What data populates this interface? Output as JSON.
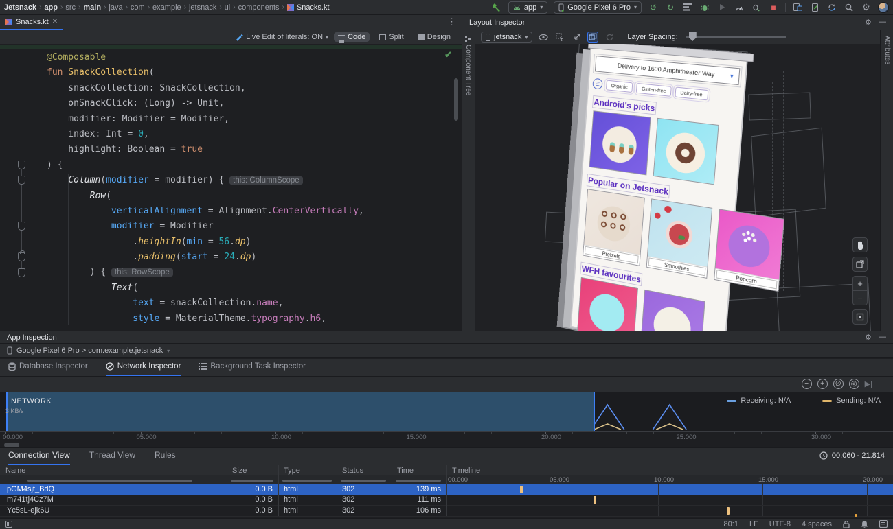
{
  "toolbar": {
    "breadcrumbs": [
      {
        "label": "Jetsnack",
        "bold": true
      },
      {
        "label": "app",
        "bold": true
      },
      {
        "label": "src",
        "bold": false
      },
      {
        "label": "main",
        "bold": true
      },
      {
        "label": "java",
        "bold": false
      },
      {
        "label": "com",
        "bold": false
      },
      {
        "label": "example",
        "bold": false
      },
      {
        "label": "jetsnack",
        "bold": false
      },
      {
        "label": "ui",
        "bold": false
      },
      {
        "label": "components",
        "bold": false
      },
      {
        "label": "Snacks.kt",
        "bold": false,
        "file": true
      }
    ],
    "run_config": "app",
    "device": "Google Pixel 6 Pro"
  },
  "editor": {
    "tab_title": "Snacks.kt",
    "live_edit_label": "Live Edit of literals: ON",
    "modes": [
      "Code",
      "Split",
      "Design"
    ],
    "active_mode": "Code",
    "code_lines": [
      [
        [
          "ann",
          "@Composable"
        ]
      ],
      [
        [
          "k",
          "fun "
        ],
        [
          "fd",
          "SnackCollection"
        ],
        [
          "p",
          "("
        ]
      ],
      [
        [
          "p",
          "    snackCollection: SnackCollection,"
        ]
      ],
      [
        [
          "p",
          "    onSnackClick: (Long) -> Unit,"
        ]
      ],
      [
        [
          "p",
          "    modifier: Modifier = Modifier,"
        ]
      ],
      [
        [
          "p",
          "    index: Int = "
        ],
        [
          "num",
          "0"
        ],
        [
          "p",
          ","
        ]
      ],
      [
        [
          "p",
          "    highlight: Boolean = "
        ],
        [
          "k",
          "true"
        ]
      ],
      [
        [
          "p",
          ") {"
        ]
      ],
      [
        [
          "p",
          "    "
        ],
        [
          "call",
          "Column"
        ],
        [
          "p",
          "("
        ],
        [
          "np",
          "modifier"
        ],
        [
          "p",
          " = modifier) { "
        ],
        [
          "hint",
          "this: ColumnScope"
        ]
      ],
      [
        [
          "p",
          "        "
        ],
        [
          "call",
          "Row"
        ],
        [
          "p",
          "("
        ]
      ],
      [
        [
          "p",
          "            "
        ],
        [
          "np",
          "verticalAlignment"
        ],
        [
          "p",
          " = Alignment."
        ],
        [
          "prop",
          "CenterVertically"
        ],
        [
          "p",
          ","
        ]
      ],
      [
        [
          "p",
          "            "
        ],
        [
          "np",
          "modifier"
        ],
        [
          "p",
          " = Modifier"
        ]
      ],
      [
        [
          "p",
          "                ."
        ],
        [
          "ext",
          "heightIn"
        ],
        [
          "p",
          "("
        ],
        [
          "np",
          "min"
        ],
        [
          "p",
          " = "
        ],
        [
          "num",
          "56"
        ],
        [
          "p",
          "."
        ],
        [
          "ext",
          "dp"
        ],
        [
          "p",
          ")"
        ]
      ],
      [
        [
          "p",
          "                ."
        ],
        [
          "ext",
          "padding"
        ],
        [
          "p",
          "("
        ],
        [
          "np",
          "start"
        ],
        [
          "p",
          " = "
        ],
        [
          "num",
          "24"
        ],
        [
          "p",
          "."
        ],
        [
          "ext",
          "dp"
        ],
        [
          "p",
          ")"
        ]
      ],
      [
        [
          "p",
          "        ) { "
        ],
        [
          "hint",
          "this: RowScope"
        ]
      ],
      [
        [
          "p",
          "            "
        ],
        [
          "call",
          "Text"
        ],
        [
          "p",
          "("
        ]
      ],
      [
        [
          "p",
          "                "
        ],
        [
          "np",
          "text"
        ],
        [
          "p",
          " = snackCollection."
        ],
        [
          "prop",
          "name"
        ],
        [
          "p",
          ","
        ]
      ],
      [
        [
          "p",
          "                "
        ],
        [
          "np",
          "style"
        ],
        [
          "p",
          " = MaterialTheme."
        ],
        [
          "prop",
          "typography"
        ],
        [
          "p",
          "."
        ],
        [
          "prop",
          "h6"
        ],
        [
          "p",
          ","
        ]
      ]
    ],
    "gutter_marker_lines": [
      7,
      8,
      11,
      13,
      14
    ],
    "gutter_lock_line": 13
  },
  "layout_inspector": {
    "title": "Layout Inspector",
    "process": "jetsnack",
    "layer_spacing_label": "Layer Spacing:",
    "left_tab": "Component Tree",
    "right_tab": "Attributes",
    "phone": {
      "address": "Delivery to 1600 Amphitheater Way",
      "chips": [
        "Organic",
        "Gluten-free",
        "Dairy-free"
      ],
      "sections": [
        {
          "title": "Android's picks",
          "cards": [
            {
              "label": "",
              "kind": "cupcakes",
              "bg": "#6450d8",
              "bg2": "#7e62e6",
              "circle": "#f3ece1"
            },
            {
              "label": "",
              "kind": "donut",
              "bg": "#8fe4f2",
              "bg2": "#aeecf6",
              "circle": "#f6efe2"
            }
          ]
        },
        {
          "title": "Popular on Jetsnack",
          "cards": [
            {
              "label": "Pretzels",
              "kind": "pretzels",
              "bg": "#efe7df",
              "bg2": "#e9dfd6",
              "circle": "#e6dacc"
            },
            {
              "label": "Smoothies",
              "kind": "smoothie",
              "bg": "#bfe2ee",
              "bg2": "#cdeaf3",
              "circle": "#f5e3df"
            },
            {
              "label": "Popcorn",
              "kind": "popcorn",
              "bg": "#ea59c8",
              "bg2": "#f07ad4",
              "circle": "#b272de"
            }
          ]
        },
        {
          "title": "WFH favourites",
          "cards": [
            {
              "label": "",
              "kind": "plain",
              "bg": "#e8417a",
              "bg2": "#f05c8e",
              "circle": "#a3ebf2"
            },
            {
              "label": "",
              "kind": "plain",
              "bg": "#9b68dd",
              "bg2": "#ab7ce6",
              "circle": "#f4f0e6"
            }
          ]
        }
      ]
    },
    "title_color": "#5b2fc0"
  },
  "app_inspection": {
    "title": "App Inspection",
    "process": "Google Pixel 6 Pro > com.example.jetsnack",
    "tabs": [
      "Database Inspector",
      "Network Inspector",
      "Background Task Inspector"
    ],
    "active_tab": "Network Inspector",
    "network": {
      "label": "NETWORK",
      "rate": "3 KB/s",
      "legend": [
        {
          "label": "Receiving: N/A",
          "color": "#6a9fe0"
        },
        {
          "label": "Sending: N/A",
          "color": "#e0b66a"
        }
      ],
      "selection_start_s": 0.06,
      "selection_end_s": 21.814,
      "spike_times_s": [
        3.5,
        7.5,
        14.0,
        21.2,
        22.3,
        24.6
      ],
      "axis_tick_labels": [
        "00.000",
        "05.000",
        "10.000",
        "15.000",
        "20.000",
        "25.000",
        "30.000"
      ],
      "receiving_color": "#5b8def",
      "sending_color": "#d9c089",
      "selection_bg": "#2d4f6b"
    },
    "connection": {
      "tabs": [
        "Connection View",
        "Thread View",
        "Rules"
      ],
      "active_tab": "Connection View",
      "time_range": "00.060 - 21.814",
      "columns": [
        "Name",
        "Size",
        "Type",
        "Status",
        "Time",
        "Timeline"
      ],
      "timeline_tick_labels": [
        "00.000",
        "05.000",
        "10.000",
        "15.000",
        "20.000"
      ],
      "rows": [
        {
          "name": "pGM4sjt_BdQ",
          "size": "0.0 B",
          "type": "html",
          "status": "302",
          "time": "139 ms",
          "event_s": 3.4,
          "selected": true
        },
        {
          "name": "m741tj4Cz7M",
          "size": "0.0 B",
          "type": "html",
          "status": "302",
          "time": "111 ms",
          "event_s": 6.9,
          "selected": false
        },
        {
          "name": "Yc5sL-ejk6U",
          "size": "0.0 B",
          "type": "html",
          "status": "302",
          "time": "106 ms",
          "event_s": 13.3,
          "selected": false
        }
      ],
      "marker_color": "#ecc07f",
      "selected_row_color": "#2d63c4"
    }
  },
  "status_bar": {
    "caret": "80:1",
    "line_ending": "LF",
    "encoding": "UTF-8",
    "indent": "4 spaces"
  }
}
